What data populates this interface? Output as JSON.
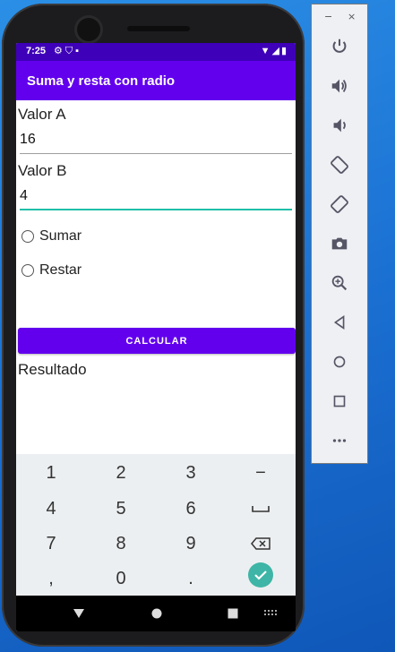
{
  "status_bar": {
    "time": "7:25",
    "left_icons": [
      "gear-icon",
      "shield-icon",
      "sd-card-icon"
    ],
    "right_icons": [
      "wifi-icon",
      "signal-icon",
      "battery-icon"
    ]
  },
  "app_bar": {
    "title": "Suma y resta con radio"
  },
  "form": {
    "valor_a_label": "Valor A",
    "valor_a_value": "16",
    "valor_b_label": "Valor B",
    "valor_b_value": "4",
    "radio_sumar": "Sumar",
    "radio_restar": "Restar",
    "button_calcular": "CALCULAR",
    "result_label": "Resultado"
  },
  "keyboard": {
    "keys": [
      "1",
      "2",
      "3",
      "−",
      "4",
      "5",
      "6",
      "␣",
      "7",
      "8",
      "9",
      "⌫",
      ",",
      "0",
      ".",
      "✓"
    ]
  },
  "nav_bar": {
    "back": "back-icon",
    "home": "home-icon",
    "recents": "recents-icon",
    "keyboard": "keyboard-icon"
  },
  "emulator_panel": {
    "window_controls": [
      "−",
      "×"
    ],
    "tools": [
      "power-icon",
      "volume-up-icon",
      "volume-down-icon",
      "rotate-left-icon",
      "rotate-right-icon",
      "camera-icon",
      "zoom-icon",
      "back-icon",
      "home-icon",
      "overview-icon",
      "more-icon"
    ]
  },
  "colors": {
    "primary": "#6200ee",
    "status_bar": "#3e00b8",
    "accent": "#1fbfa8",
    "keyboard_bg": "#eceff1"
  }
}
